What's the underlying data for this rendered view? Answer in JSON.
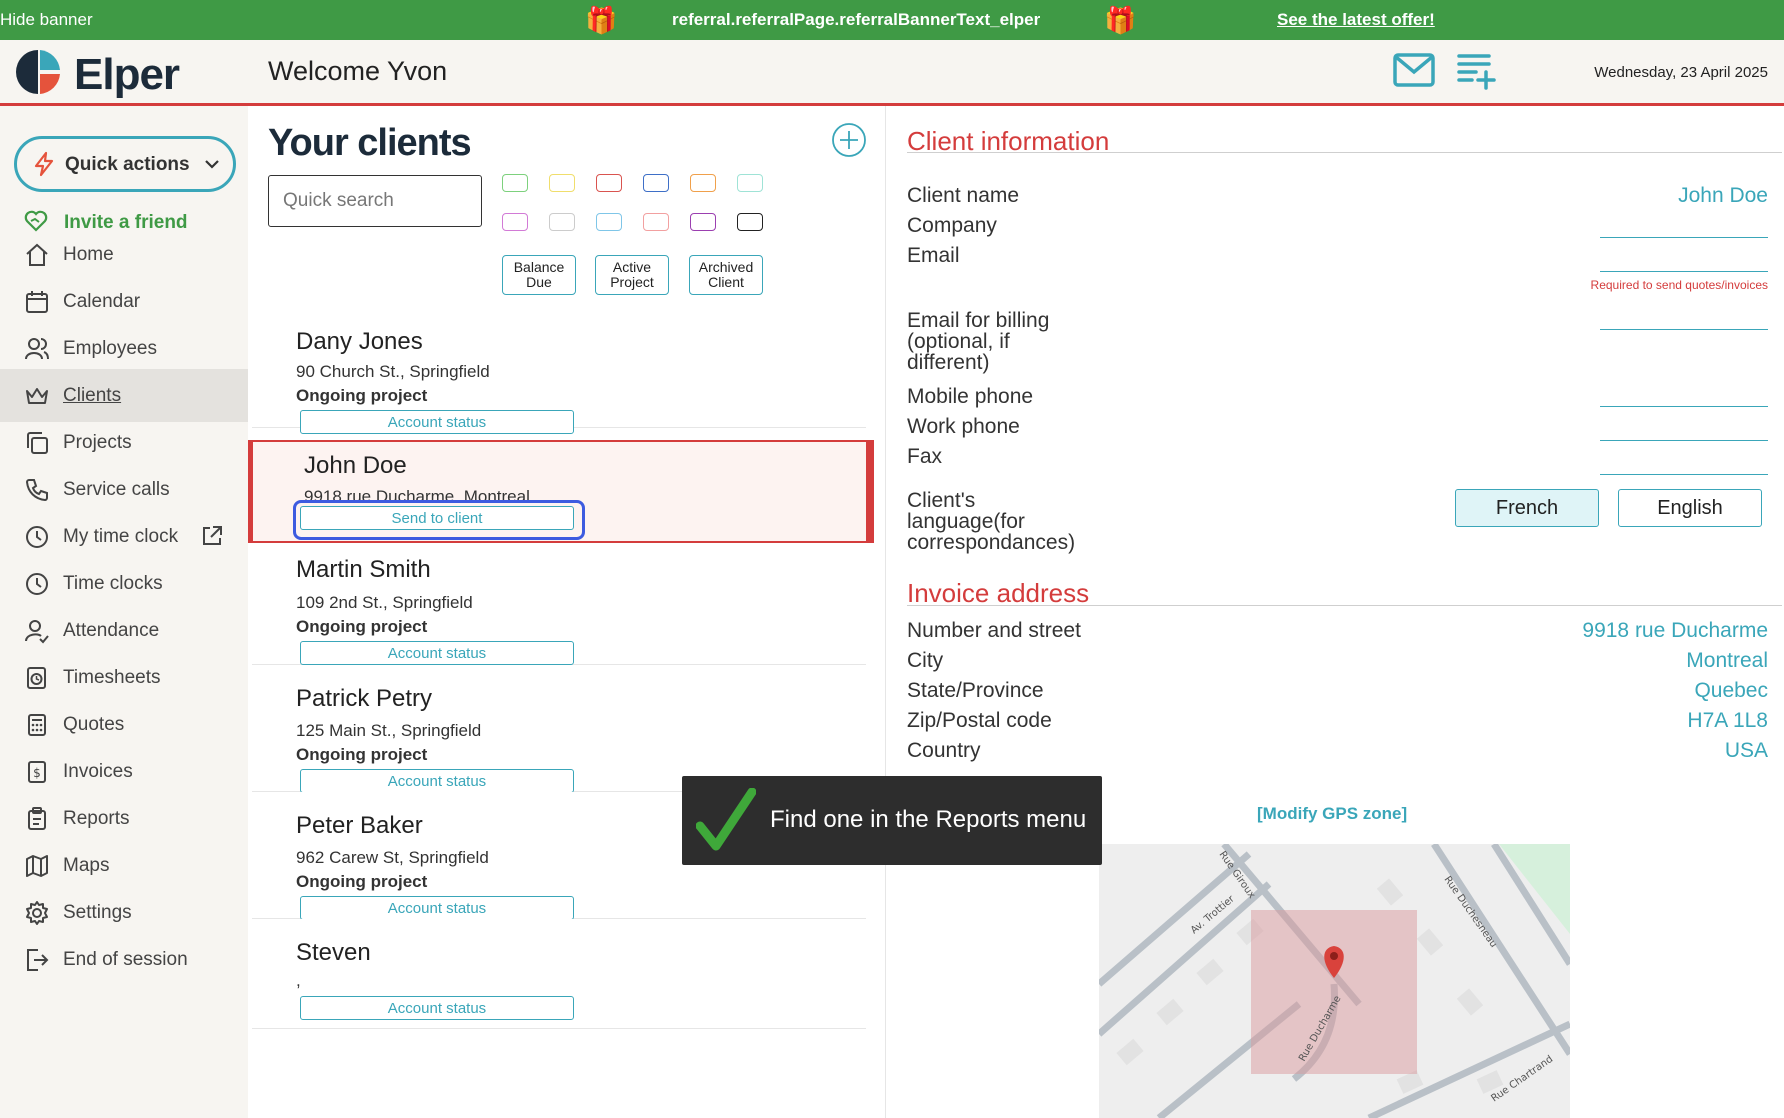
{
  "banner": {
    "hide_label": "Hide banner",
    "text": "referral.referralPage.referralBannerText_elper",
    "offer_label": "See the latest offer!",
    "gift_icon": "gift-icon",
    "bg_color": "#3f9a45"
  },
  "header": {
    "logo_text": "Elper",
    "logo_mark": "MC",
    "welcome": "Welcome Yvon",
    "date": "Wednesday, 23 April 2025",
    "accent_color": "#d43c3c"
  },
  "sidebar": {
    "quick_actions": "Quick actions",
    "invite": "Invite a friend",
    "items": [
      {
        "label": "Home",
        "icon": "home-icon"
      },
      {
        "label": "Calendar",
        "icon": "calendar-icon"
      },
      {
        "label": "Employees",
        "icon": "users-icon"
      },
      {
        "label": "Clients",
        "icon": "crown-icon",
        "active": true
      },
      {
        "label": "Projects",
        "icon": "copy-icon"
      },
      {
        "label": "Service calls",
        "icon": "phone-icon"
      },
      {
        "label": "My time clock",
        "icon": "clock-icon"
      },
      {
        "label": "Time clocks",
        "icon": "clock-icon"
      },
      {
        "label": "Attendance",
        "icon": "person-check-icon"
      },
      {
        "label": "Timesheets",
        "icon": "timesheet-icon"
      },
      {
        "label": "Quotes",
        "icon": "calculator-icon"
      },
      {
        "label": "Invoices",
        "icon": "invoice-icon"
      },
      {
        "label": "Reports",
        "icon": "clipboard-icon"
      },
      {
        "label": "Maps",
        "icon": "map-icon"
      },
      {
        "label": "Settings",
        "icon": "gear-icon"
      },
      {
        "label": "End of session",
        "icon": "logout-icon"
      }
    ]
  },
  "clients": {
    "title": "Your clients",
    "search_placeholder": "Quick search",
    "filters": {
      "balance_due": [
        "Balance",
        "Due"
      ],
      "active_project": [
        "Active",
        "Project"
      ],
      "archived_client": [
        "Archived",
        "Client"
      ]
    },
    "tag_colors": [
      "#7dd17d",
      "#f0de6c",
      "#d9534f",
      "#3e6fc7",
      "#f0a04b",
      "#9fe3d6",
      "#d27ad6",
      "#cccccc",
      "#7fc6e8",
      "#f2a0a0",
      "#9b3fb0",
      "#222222"
    ],
    "list": [
      {
        "name": "Dany Jones",
        "address": "90 Church St., Springfield",
        "status": "Ongoing project",
        "button": "Account status"
      },
      {
        "name": "John Doe",
        "address": "9918 rue Ducharme, Montreal",
        "status": "",
        "button": "Send to client",
        "selected": true
      },
      {
        "name": "Martin Smith",
        "address": "109 2nd St., Springfield",
        "status": "Ongoing project",
        "button": "Account status"
      },
      {
        "name": "Patrick Petry",
        "address": "125 Main St., Springfield",
        "status": "Ongoing project",
        "button": "Account status"
      },
      {
        "name": "Peter Baker",
        "address": "962 Carew St, Springfield",
        "status": "Ongoing project",
        "button": "Account status"
      },
      {
        "name": "Steven",
        "address": ",",
        "status": "",
        "button": "Account status"
      }
    ]
  },
  "toast": {
    "message": "Find one in the Reports menu",
    "icon": "checkmark-icon"
  },
  "client_info": {
    "title": "Client information",
    "fields": {
      "client_name": {
        "label": "Client name",
        "value": "John Doe"
      },
      "company": {
        "label": "Company",
        "value": ""
      },
      "email": {
        "label": "Email",
        "value": "",
        "hint": "Required to send quotes/invoices"
      },
      "billing_email": {
        "label": "Email for billing (optional, if different)",
        "value": ""
      },
      "mobile": {
        "label": "Mobile phone",
        "value": ""
      },
      "work": {
        "label": "Work phone",
        "value": ""
      },
      "fax": {
        "label": "Fax",
        "value": ""
      },
      "language": {
        "label": "Client's language(for correspondances)",
        "options": [
          "French",
          "English"
        ],
        "selected": "French"
      }
    }
  },
  "invoice_address": {
    "title": "Invoice address",
    "street": {
      "label": "Number and street",
      "value": "9918 rue Ducharme"
    },
    "city": {
      "label": "City",
      "value": "Montreal"
    },
    "state": {
      "label": "State/Province",
      "value": "Quebec"
    },
    "zip": {
      "label": "Zip/Postal code",
      "value": "H7A 1L8"
    },
    "country": {
      "label": "Country",
      "value": "USA"
    },
    "gps_link": "[Modify GPS zone]"
  },
  "map": {
    "streets": [
      "Rue Giroux",
      "Av. Trottier",
      "Rue Ducharme",
      "Rue Duchesneau",
      "Rue Chartrand"
    ]
  }
}
